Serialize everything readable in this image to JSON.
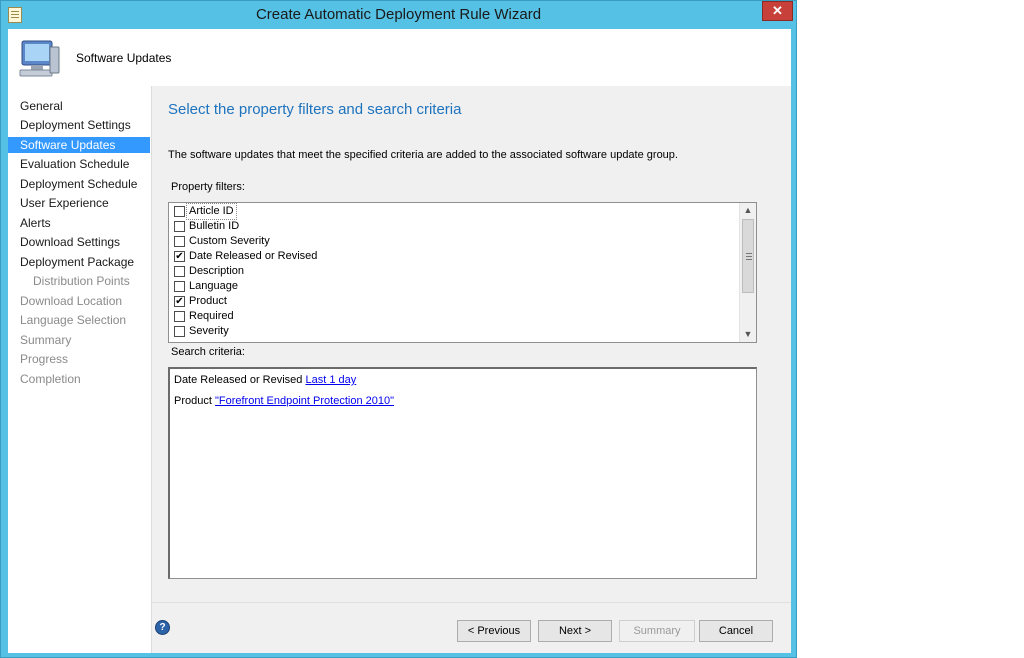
{
  "window": {
    "title": "Create Automatic Deployment Rule Wizard",
    "close_glyph": "✕"
  },
  "header": {
    "title": "Software Updates",
    "icon": "computer-icon"
  },
  "nav": {
    "items": [
      {
        "label": "General",
        "state": "normal"
      },
      {
        "label": "Deployment Settings",
        "state": "normal"
      },
      {
        "label": "Software Updates",
        "state": "selected"
      },
      {
        "label": "Evaluation Schedule",
        "state": "normal"
      },
      {
        "label": "Deployment Schedule",
        "state": "normal"
      },
      {
        "label": "User Experience",
        "state": "normal"
      },
      {
        "label": "Alerts",
        "state": "normal"
      },
      {
        "label": "Download Settings",
        "state": "normal"
      },
      {
        "label": "Deployment Package",
        "state": "normal"
      },
      {
        "label": "Distribution Points",
        "state": "disabled-sub"
      },
      {
        "label": "Download Location",
        "state": "disabled"
      },
      {
        "label": "Language Selection",
        "state": "disabled"
      },
      {
        "label": "Summary",
        "state": "disabled"
      },
      {
        "label": "Progress",
        "state": "disabled"
      },
      {
        "label": "Completion",
        "state": "disabled"
      }
    ]
  },
  "main": {
    "page_title": "Select the property filters and search criteria",
    "description": "The software updates that meet the specified criteria are added to the associated software update group.",
    "filters_label": "Property filters:",
    "filters": [
      {
        "label": "Article ID",
        "checked": false,
        "focused": true
      },
      {
        "label": "Bulletin ID",
        "checked": false
      },
      {
        "label": "Custom Severity",
        "checked": false
      },
      {
        "label": "Date Released or Revised",
        "checked": true
      },
      {
        "label": "Description",
        "checked": false
      },
      {
        "label": "Language",
        "checked": false
      },
      {
        "label": "Product",
        "checked": true
      },
      {
        "label": "Required",
        "checked": false
      },
      {
        "label": "Severity",
        "checked": false
      }
    ],
    "criteria_label": "Search criteria:",
    "criteria": [
      {
        "prefix": "Date Released or Revised ",
        "link": "Last 1 day"
      },
      {
        "prefix": "Product ",
        "link": "\"Forefront Endpoint Protection 2010\""
      }
    ]
  },
  "buttons": {
    "previous": "< Previous",
    "next": "Next >",
    "summary": "Summary",
    "cancel": "Cancel",
    "help": "?"
  },
  "colors": {
    "frame": "#55c1e4",
    "accent_title": "#1e73be",
    "selection": "#3399ff",
    "close": "#c7403a"
  }
}
